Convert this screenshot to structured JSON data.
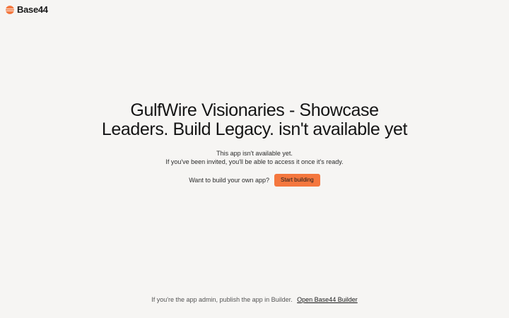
{
  "brand": {
    "name": "Base44",
    "logo_icon": "base44-logo-icon",
    "accent_color": "#f4773e"
  },
  "main": {
    "title": "GulfWire Visionaries - Showcase Leaders. Build Legacy. isn't available yet",
    "subtitle_line1": "This app isn't available yet.",
    "subtitle_line2": "If you've been invited, you'll be able to access it once it's ready.",
    "cta_prompt": "Want to build your own app?",
    "cta_button": "Start building"
  },
  "footer": {
    "text": "If you're the app admin, publish the app in Builder.",
    "link": "Open Base44 Builder"
  }
}
